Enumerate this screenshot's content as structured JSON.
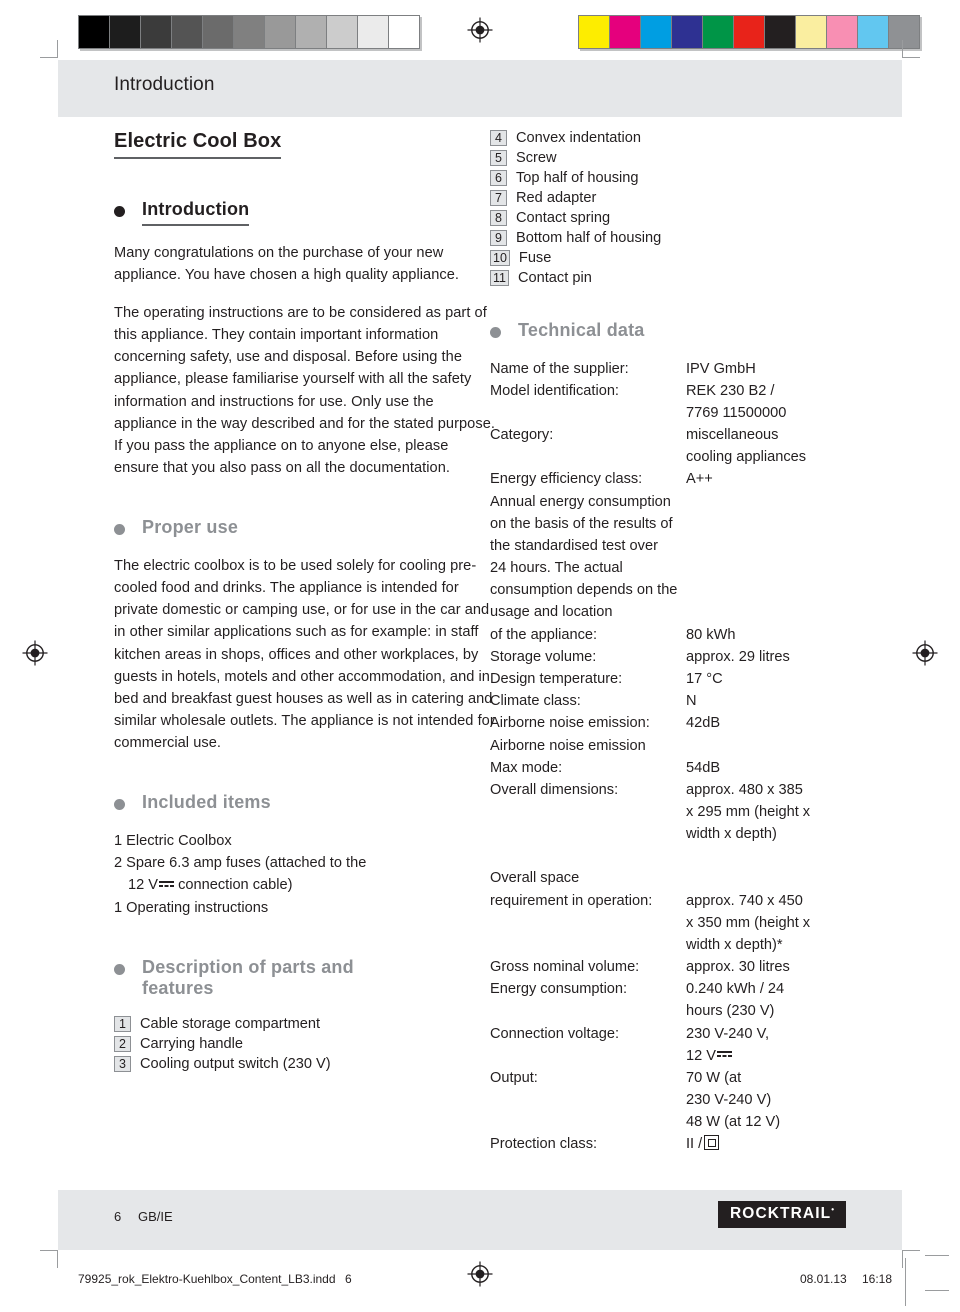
{
  "prepress": {
    "gray_ramp": [
      "#000000",
      "#1d1d1d",
      "#3b3b3b",
      "#545454",
      "#6b6b6b",
      "#808080",
      "#999999",
      "#b0b0b0",
      "#cccccc",
      "#ebebeb",
      "#ffffff"
    ],
    "color_ramp": [
      "#fded00",
      "#e5007d",
      "#009ee2",
      "#2e3192",
      "#009547",
      "#e8231a",
      "#231f20",
      "#faeea0",
      "#f88fb3",
      "#62c7f0",
      "#8f9194"
    ],
    "registration_mark": "registration-target-icon"
  },
  "header": {
    "running_head": "Introduction"
  },
  "left_column": {
    "doc_title": "Electric Cool Box",
    "intro": {
      "heading": "Introduction",
      "paragraphs": [
        "Many congratulations on the purchase of your new appliance. You have chosen a high quality appliance.",
        "The operating instructions are to be considered as part of this appliance. They contain important information concerning safety, use and disposal. Before using the appliance, please familiarise yourself with all the safety information and instructions for use. Only use the appliance in the way described and for the stated purpose. If you pass the appliance on to anyone else, please ensure that you also pass on all the documentation."
      ]
    },
    "proper_use": {
      "heading": "Proper use",
      "paragraph": "The electric coolbox is to be used solely for cooling pre-cooled food and drinks. The appliance is intended for private domestic or camping use, or for use in the car and in other similar applications such as for example: in staff kitchen areas in shops, offices and other workplaces, by guests in hotels, motels and other accommodation, and in bed and breakfast guest houses as well as in catering and similar wholesale outlets. The appliance is not intended for commercial use."
    },
    "included_items": {
      "heading": "Included items",
      "items": [
        {
          "text": "1 Electric Coolbox",
          "indent": ""
        },
        {
          "text": "2 Spare 6.3 amp fuses (attached to the",
          "indent": "12 V"
        },
        {
          "indent_tail": " connection cable)"
        },
        {
          "text": "1 Operating instructions",
          "indent": ""
        }
      ]
    },
    "parts_description": {
      "heading_line1": "Description of parts and",
      "heading_line2": "features",
      "parts": [
        {
          "num": "1",
          "label": "Cable storage compartment"
        },
        {
          "num": "2",
          "label": "Carrying handle"
        },
        {
          "num": "3",
          "label": "Cooling output switch (230 V)"
        }
      ]
    }
  },
  "right_column": {
    "parts_continued": [
      {
        "num": "4",
        "label": "Convex indentation"
      },
      {
        "num": "5",
        "label": "Screw"
      },
      {
        "num": "6",
        "label": "Top half of housing"
      },
      {
        "num": "7",
        "label": "Red adapter"
      },
      {
        "num": "8",
        "label": "Contact spring"
      },
      {
        "num": "9",
        "label": "Bottom half of housing"
      },
      {
        "num": "10",
        "label": "Fuse"
      },
      {
        "num": "11",
        "label": "Contact pin"
      }
    ],
    "technical_data": {
      "heading": "Technical data",
      "rows": [
        {
          "key": "Name of the supplier:",
          "val": "IPV GmbH"
        },
        {
          "key": "Model identification:",
          "val": "REK 230 B2 /"
        },
        {
          "key": "",
          "val": "7769 11500000"
        },
        {
          "key": "Category:",
          "val": "miscellaneous"
        },
        {
          "key": "",
          "val": "cooling appliances"
        },
        {
          "key": "Energy efficiency class:",
          "val": "A++"
        },
        {
          "key": "Annual energy consumption",
          "val": ""
        },
        {
          "key": "on the basis of the results of",
          "val": ""
        },
        {
          "key": "the standardised test over",
          "val": ""
        },
        {
          "key": "24 hours. The actual",
          "val": ""
        },
        {
          "key": "consumption depends on the",
          "val": ""
        },
        {
          "key": "usage and location",
          "val": ""
        },
        {
          "key": "of the appliance:",
          "val": "80 kWh"
        },
        {
          "key": "Storage volume:",
          "val": "approx. 29 litres"
        },
        {
          "key": "Design temperature:",
          "val": "17 °C"
        },
        {
          "key": "Climate class:",
          "val": "N"
        },
        {
          "key": "Airborne noise emission:",
          "val": "42dB"
        },
        {
          "key": "Airborne noise emission",
          "val": ""
        },
        {
          "key": "Max mode:",
          "val": "54dB"
        },
        {
          "key": "Overall dimensions:",
          "val": "approx. 480 x 385"
        },
        {
          "key": "",
          "val": "x 295 mm (height x"
        },
        {
          "key": "",
          "val": "width x depth)"
        },
        {
          "key": "__SPACER__",
          "val": ""
        },
        {
          "key": "Overall space",
          "val": ""
        },
        {
          "key": "requirement in operation:",
          "val": "approx. 740 x 450"
        },
        {
          "key": "",
          "val": "x 350 mm (height x"
        },
        {
          "key": "",
          "val": "width x depth)*"
        },
        {
          "key": "Gross nominal volume:",
          "val": "approx. 30 litres"
        },
        {
          "key": "Energy consumption:",
          "val": "0.240 kWh / 24"
        },
        {
          "key": "",
          "val": "hours (230 V)"
        },
        {
          "key": "Connection voltage:",
          "val": "230 V-240 V,"
        },
        {
          "key": "",
          "val": "__DC12V__"
        },
        {
          "key": "Output:",
          "val": "70 W (at"
        },
        {
          "key": "",
          "val": "230 V-240 V)"
        },
        {
          "key": "",
          "val": "48 W (at 12 V)"
        },
        {
          "key": "Protection class:",
          "val": "__CLASS2__"
        }
      ]
    }
  },
  "footer": {
    "page_number": "6",
    "locale": "GB/IE",
    "brand": "ROCKTRAIL",
    "brand_mark": "•"
  },
  "slug": {
    "file": "79925_rok_Elektro-Kuehlbox_Content_LB3.indd",
    "page": "6",
    "date": "08.01.13",
    "time": "16:18"
  }
}
